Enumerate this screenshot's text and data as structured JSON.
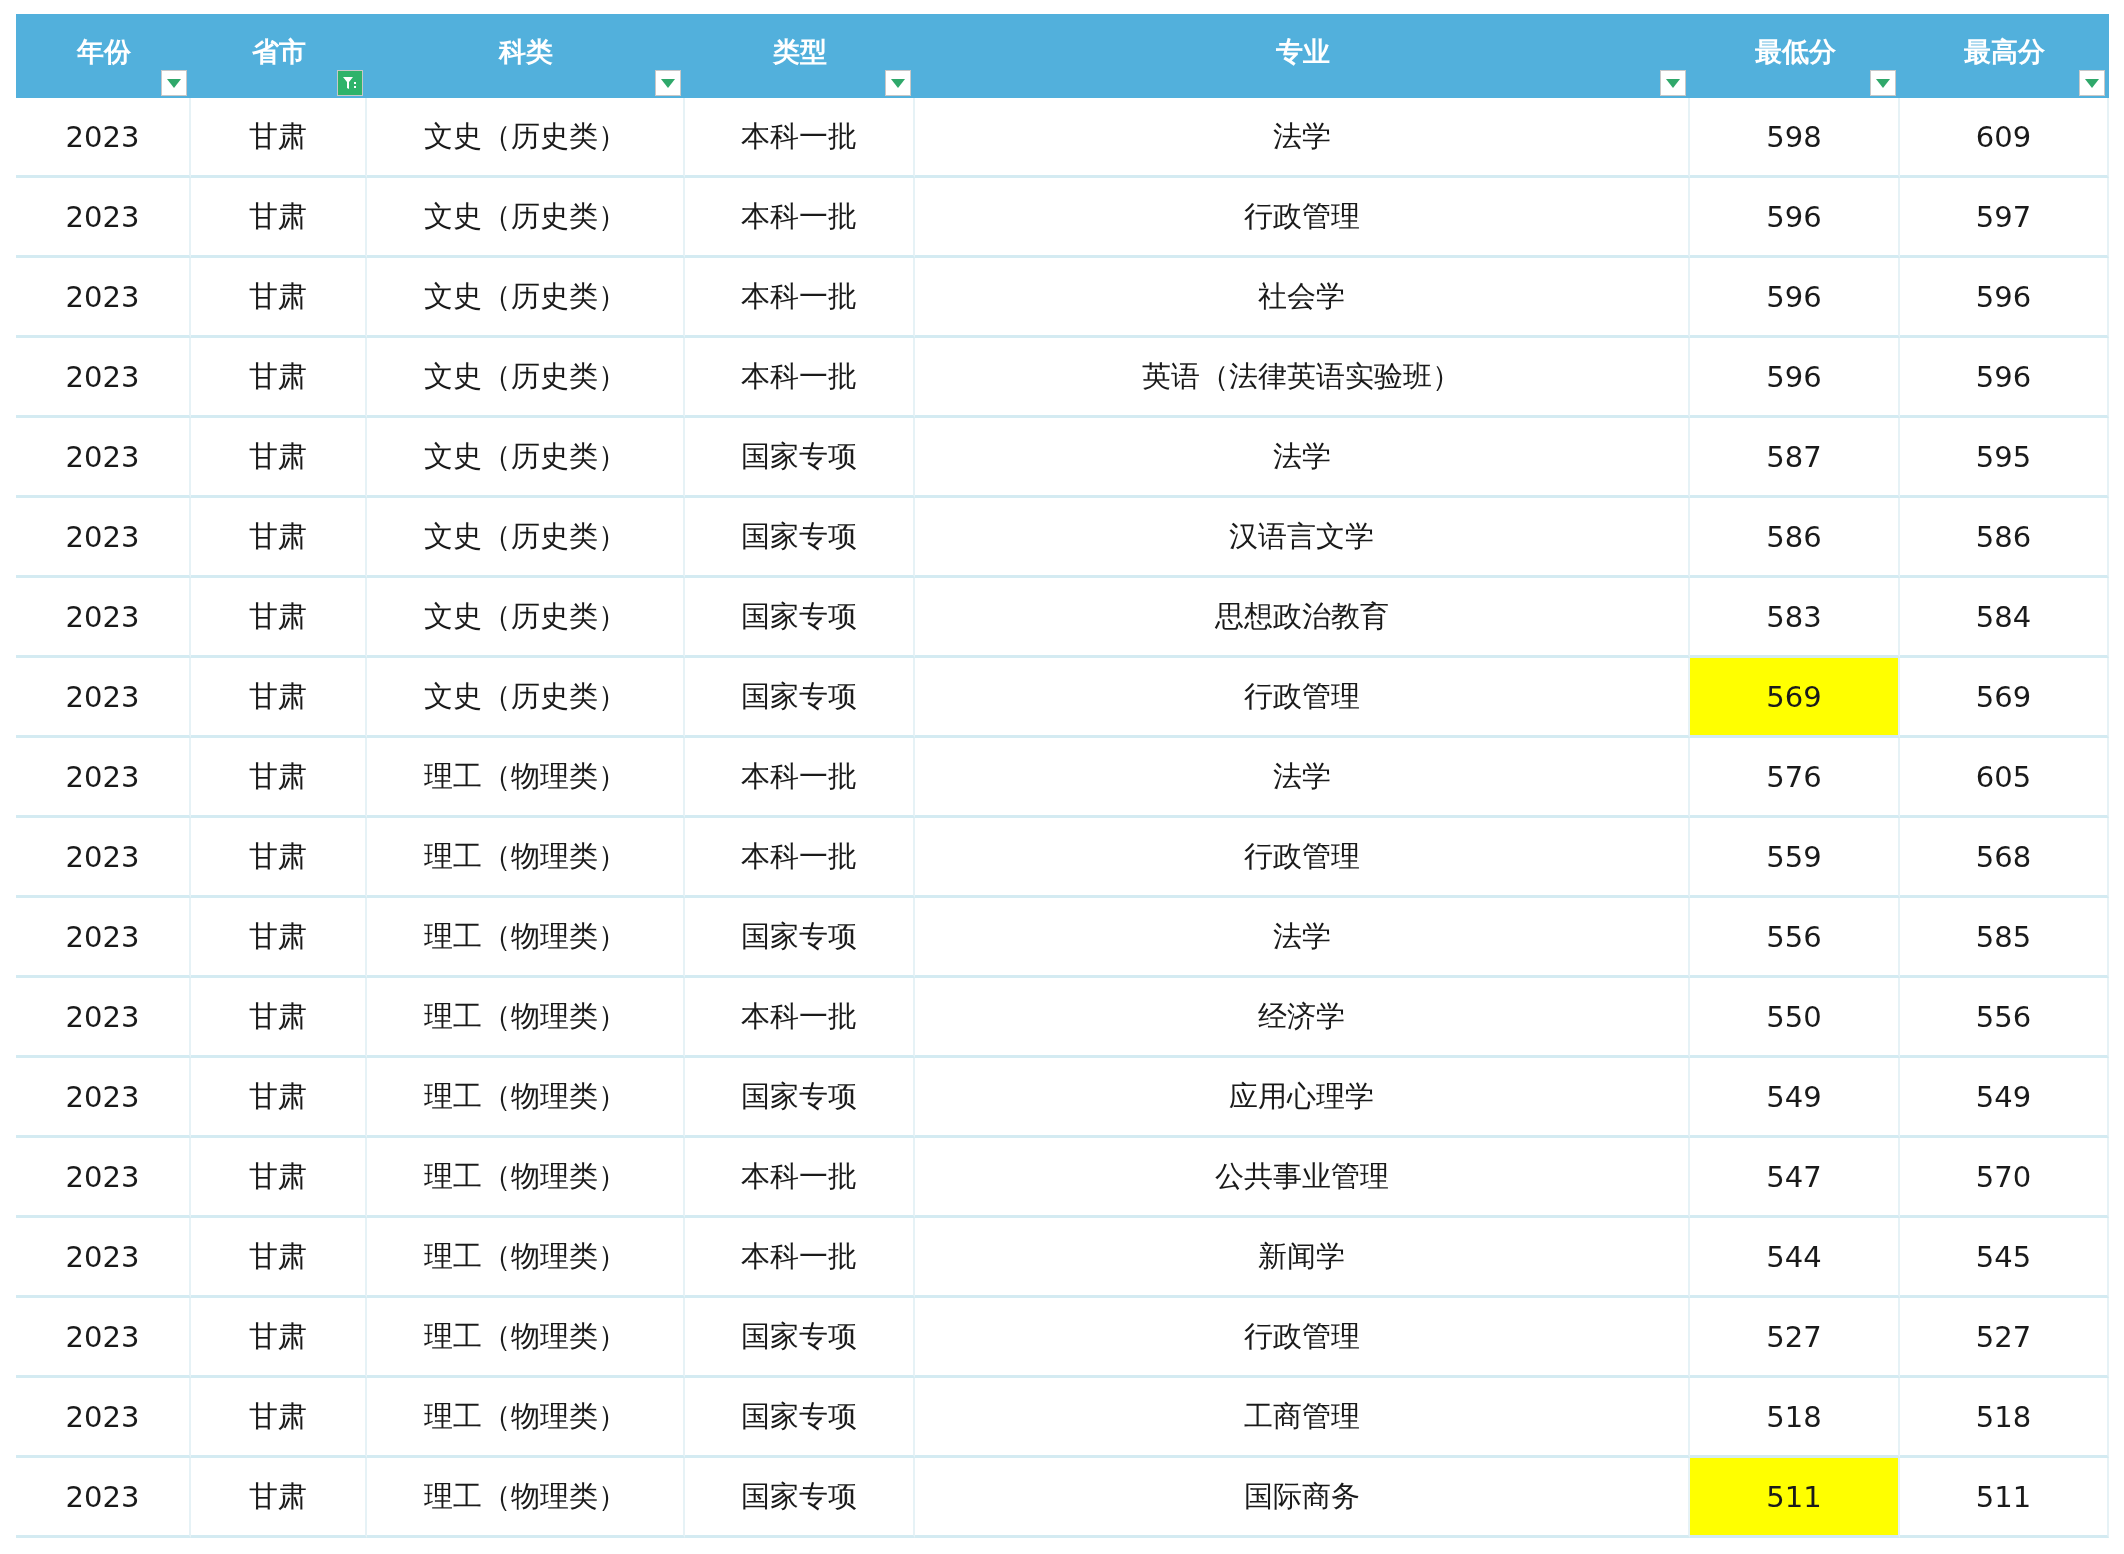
{
  "table": {
    "columns": [
      {
        "label": "年份",
        "filtered": false
      },
      {
        "label": "省市",
        "filtered": true
      },
      {
        "label": "科类",
        "filtered": false
      },
      {
        "label": "类型",
        "filtered": false
      },
      {
        "label": "专业",
        "filtered": false
      },
      {
        "label": "最低分",
        "filtered": false
      },
      {
        "label": "最高分",
        "filtered": false
      }
    ],
    "rows": [
      {
        "cells": [
          "2023",
          "甘肃",
          "文史（历史类）",
          "本科一批",
          "法学",
          "598",
          "609"
        ],
        "min_highlighted": false
      },
      {
        "cells": [
          "2023",
          "甘肃",
          "文史（历史类）",
          "本科一批",
          "行政管理",
          "596",
          "597"
        ],
        "min_highlighted": false
      },
      {
        "cells": [
          "2023",
          "甘肃",
          "文史（历史类）",
          "本科一批",
          "社会学",
          "596",
          "596"
        ],
        "min_highlighted": false
      },
      {
        "cells": [
          "2023",
          "甘肃",
          "文史（历史类）",
          "本科一批",
          "英语（法律英语实验班）",
          "596",
          "596"
        ],
        "min_highlighted": false
      },
      {
        "cells": [
          "2023",
          "甘肃",
          "文史（历史类）",
          "国家专项",
          "法学",
          "587",
          "595"
        ],
        "min_highlighted": false
      },
      {
        "cells": [
          "2023",
          "甘肃",
          "文史（历史类）",
          "国家专项",
          "汉语言文学",
          "586",
          "586"
        ],
        "min_highlighted": false
      },
      {
        "cells": [
          "2023",
          "甘肃",
          "文史（历史类）",
          "国家专项",
          "思想政治教育",
          "583",
          "584"
        ],
        "min_highlighted": false
      },
      {
        "cells": [
          "2023",
          "甘肃",
          "文史（历史类）",
          "国家专项",
          "行政管理",
          "569",
          "569"
        ],
        "min_highlighted": true
      },
      {
        "cells": [
          "2023",
          "甘肃",
          "理工（物理类）",
          "本科一批",
          "法学",
          "576",
          "605"
        ],
        "min_highlighted": false
      },
      {
        "cells": [
          "2023",
          "甘肃",
          "理工（物理类）",
          "本科一批",
          "行政管理",
          "559",
          "568"
        ],
        "min_highlighted": false
      },
      {
        "cells": [
          "2023",
          "甘肃",
          "理工（物理类）",
          "国家专项",
          "法学",
          "556",
          "585"
        ],
        "min_highlighted": false
      },
      {
        "cells": [
          "2023",
          "甘肃",
          "理工（物理类）",
          "本科一批",
          "经济学",
          "550",
          "556"
        ],
        "min_highlighted": false
      },
      {
        "cells": [
          "2023",
          "甘肃",
          "理工（物理类）",
          "国家专项",
          "应用心理学",
          "549",
          "549"
        ],
        "min_highlighted": false
      },
      {
        "cells": [
          "2023",
          "甘肃",
          "理工（物理类）",
          "本科一批",
          "公共事业管理",
          "547",
          "570"
        ],
        "min_highlighted": false
      },
      {
        "cells": [
          "2023",
          "甘肃",
          "理工（物理类）",
          "本科一批",
          "新闻学",
          "544",
          "545"
        ],
        "min_highlighted": false
      },
      {
        "cells": [
          "2023",
          "甘肃",
          "理工（物理类）",
          "国家专项",
          "行政管理",
          "527",
          "527"
        ],
        "min_highlighted": false
      },
      {
        "cells": [
          "2023",
          "甘肃",
          "理工（物理类）",
          "国家专项",
          "工商管理",
          "518",
          "518"
        ],
        "min_highlighted": false
      },
      {
        "cells": [
          "2023",
          "甘肃",
          "理工（物理类）",
          "国家专项",
          "国际商务",
          "511",
          "511"
        ],
        "min_highlighted": true
      }
    ]
  }
}
